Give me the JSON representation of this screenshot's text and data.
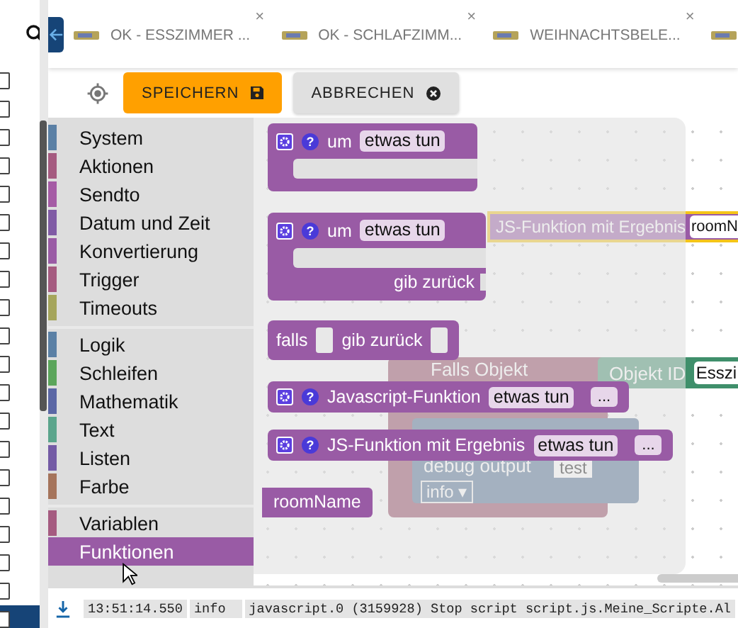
{
  "sidebar": {
    "rows": [
      {
        "checked": false,
        "selected": false
      },
      {
        "checked": false,
        "selected": false
      },
      {
        "checked": false,
        "selected": false
      },
      {
        "checked": false,
        "selected": false
      },
      {
        "checked": false,
        "selected": false
      },
      {
        "checked": false,
        "selected": false
      },
      {
        "checked": false,
        "selected": false
      },
      {
        "checked": false,
        "selected": false
      },
      {
        "checked": false,
        "selected": false
      },
      {
        "checked": false,
        "selected": false
      },
      {
        "checked": false,
        "selected": false
      },
      {
        "checked": false,
        "selected": false
      },
      {
        "checked": false,
        "selected": false
      },
      {
        "checked": false,
        "selected": false
      },
      {
        "checked": false,
        "selected": false
      },
      {
        "checked": false,
        "selected": false
      },
      {
        "checked": false,
        "selected": false
      },
      {
        "checked": false,
        "selected": false
      },
      {
        "checked": false,
        "selected": false
      },
      {
        "checked": false,
        "selected": true
      }
    ]
  },
  "tabs": [
    {
      "label": "OK - ESSZIMMER ...",
      "close": "×",
      "selected": false
    },
    {
      "label": "OK - SCHLAFZIMM...",
      "close": "×",
      "selected": false
    },
    {
      "label": "WEIHNACHTSBELE...",
      "close": "×",
      "selected": false
    },
    {
      "selected": false
    }
  ],
  "toolbar": {
    "save": "SPEICHERN",
    "cancel": "ABBRECHEN"
  },
  "toolbox": [
    [
      {
        "label": "System",
        "color": "#5b80a5",
        "selected": false
      },
      {
        "label": "Aktionen",
        "color": "#a55b80",
        "selected": false
      },
      {
        "label": "Sendto",
        "color": "#a55ba5",
        "selected": false
      },
      {
        "label": "Datum und Zeit",
        "color": "#805ba5",
        "selected": false
      },
      {
        "label": "Konvertierung",
        "color": "#9a5ba5",
        "selected": false
      },
      {
        "label": "Trigger",
        "color": "#a55b80",
        "selected": false
      },
      {
        "label": "Timeouts",
        "color": "#a5a55b",
        "selected": false
      }
    ],
    [
      {
        "label": "Logik",
        "color": "#5b80a5",
        "selected": false
      },
      {
        "label": "Schleifen",
        "color": "#5ba55b",
        "selected": false
      },
      {
        "label": "Mathematik",
        "color": "#5b67a5",
        "selected": false
      },
      {
        "label": "Text",
        "color": "#5ba58c",
        "selected": false
      },
      {
        "label": "Listen",
        "color": "#745ba5",
        "selected": false
      },
      {
        "label": "Farbe",
        "color": "#a5745b",
        "selected": false
      }
    ],
    [
      {
        "label": "Variablen",
        "color": "#a55b80",
        "selected": false
      },
      {
        "label": "Funktionen",
        "color": "#995ba5",
        "selected": true
      }
    ]
  ],
  "flyout": [
    {
      "kind": "procedure",
      "help": "?",
      "label": "um",
      "field": "etwas tun"
    },
    {
      "kind": "procedure_return",
      "help": "?",
      "label": "um",
      "field": "etwas tun",
      "return_label": "gib zurück"
    },
    {
      "kind": "if_return",
      "label": "falls",
      "return_label": "gib zurück"
    },
    {
      "kind": "js_function",
      "help": "?",
      "label": "Javascript-Funktion",
      "field": "etwas tun",
      "more": "..."
    },
    {
      "kind": "js_function",
      "help": "?",
      "label": "JS-Funktion mit Ergebnis",
      "field": "etwas tun",
      "more": "..."
    },
    {
      "kind": "variable",
      "label": "roomName"
    }
  ],
  "workspace": {
    "js_block": {
      "label": "JS-Funktion mit Ergebnis",
      "field": "roomN"
    },
    "if_block": {
      "label": "Falls Objekt"
    },
    "object_block": {
      "label": "Objekt ID",
      "field": "Esszi"
    },
    "debug_block": {
      "label": "debug output",
      "text": "test",
      "level": "info ▾"
    }
  },
  "log": {
    "time": "13:51:14.550",
    "severity": "info",
    "message": "javascript.0 (3159928) Stop script script.js.Meine_Scripte.Al"
  }
}
